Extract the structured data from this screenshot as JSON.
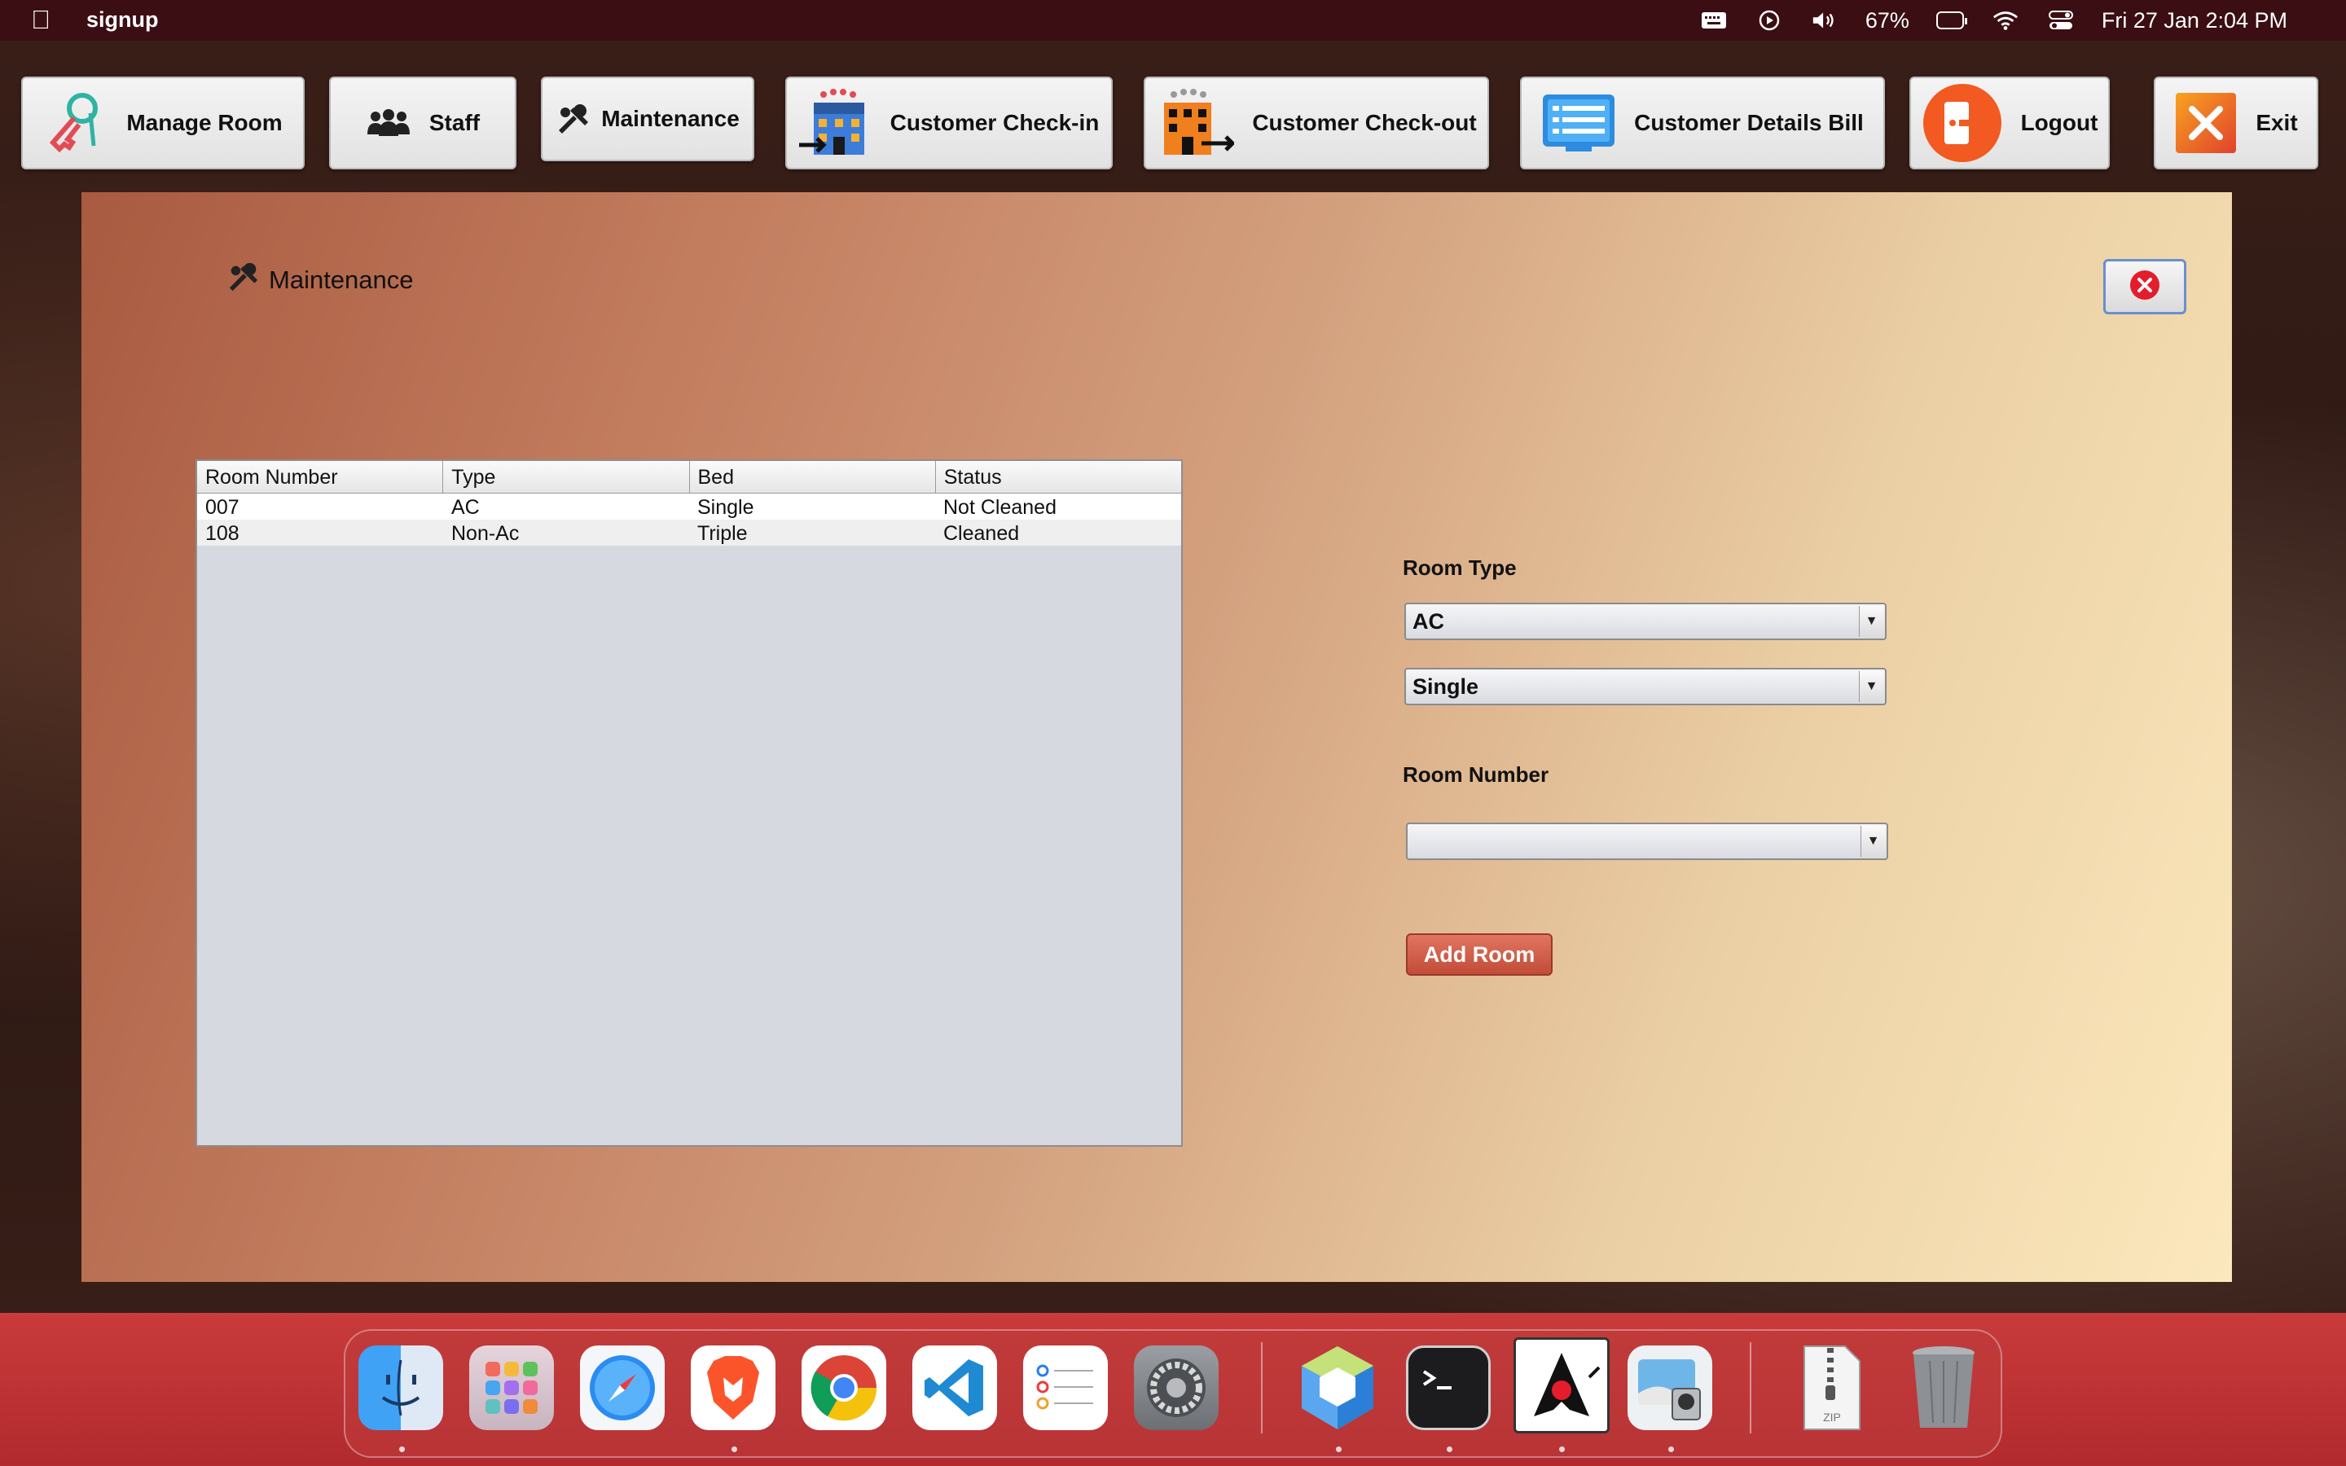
{
  "menubar": {
    "app_name": "signup",
    "battery": "67%",
    "datetime": "Fri 27 Jan  2:04 PM"
  },
  "toolbar": {
    "manage_room": "Manage Room",
    "staff": "Staff",
    "maintenance": "Maintenance",
    "checkin": "Customer Check-in",
    "checkout": "Customer Check-out",
    "details_bill": "Customer Details Bill",
    "logout": "Logout",
    "exit": "Exit"
  },
  "panel": {
    "title": "Maintenance"
  },
  "table": {
    "headers": [
      "Room Number",
      "Type",
      "Bed",
      "Status"
    ],
    "rows": [
      [
        "007",
        "AC",
        "Single",
        "Not Cleaned"
      ],
      [
        "108",
        "Non-Ac",
        "Triple",
        "Cleaned"
      ]
    ]
  },
  "form": {
    "room_type_label": "Room Type",
    "room_type_value": "AC",
    "bed_value": "Single",
    "room_number_label": "Room Number",
    "room_number_value": "",
    "add_button": "Add Room"
  },
  "dock": {
    "apps": [
      "finder-icon",
      "launchpad-icon",
      "safari-icon",
      "brave-icon",
      "chrome-icon",
      "vscode-icon",
      "reminders-icon",
      "system-settings-icon",
      "netbeans-icon",
      "terminal-icon",
      "java-icon",
      "preview-icon",
      "zip-archive-icon",
      "trash-icon"
    ],
    "zip_label": "ZIP"
  },
  "colors": {
    "menubar": "#3a0e12",
    "panel_start": "#a95a40",
    "panel_end": "#fbe8bc",
    "add_button": "#c24c38",
    "dock": "#c93b3b"
  }
}
